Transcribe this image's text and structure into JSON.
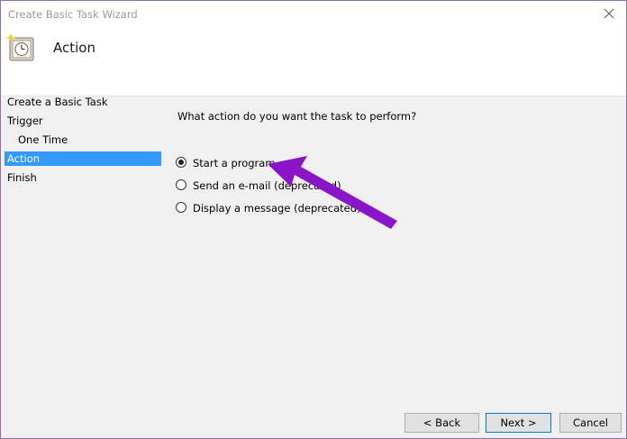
{
  "window": {
    "title": "Create Basic Task Wizard"
  },
  "header": {
    "title": "Action",
    "icon": "task-scheduler-clock-icon"
  },
  "steps": [
    {
      "label": "Create a Basic Task",
      "active": false
    },
    {
      "label": "Trigger",
      "active": false
    },
    {
      "label": "One Time",
      "active": false
    },
    {
      "label": "Action",
      "active": true
    },
    {
      "label": "Finish",
      "active": false
    }
  ],
  "main": {
    "question": "What action do you want the task to perform?",
    "options": [
      {
        "label": "Start a program",
        "checked": true
      },
      {
        "label": "Send an e-mail (deprecated)",
        "checked": false
      },
      {
        "label": "Display a message (deprecated)",
        "checked": false
      }
    ]
  },
  "buttons": {
    "back": "< Back",
    "next": "Next >",
    "cancel": "Cancel"
  },
  "colors": {
    "selection": "#3399ff",
    "annotation_arrow": "#8a14c8",
    "window_border": "#8c6fa8"
  }
}
